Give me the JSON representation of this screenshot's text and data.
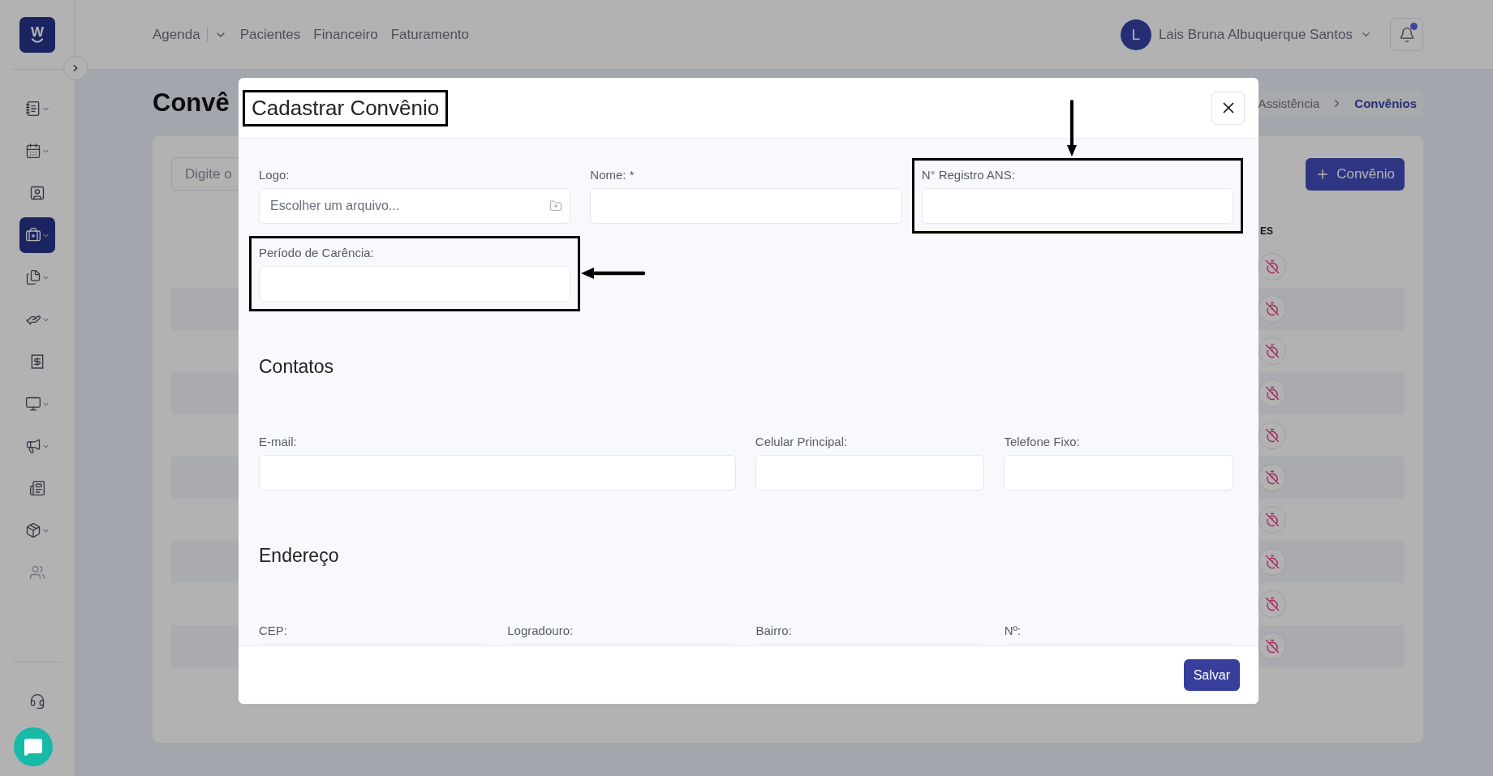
{
  "logo": {
    "letter": "W"
  },
  "sidebar": {
    "items": [
      {
        "kind": "notebook",
        "expandable": true,
        "selected": false,
        "disabled": false
      },
      {
        "kind": "calendar",
        "expandable": true,
        "selected": false,
        "disabled": false
      },
      {
        "kind": "contact",
        "expandable": false,
        "selected": false,
        "disabled": false
      },
      {
        "kind": "medical",
        "expandable": true,
        "selected": true,
        "disabled": false
      },
      {
        "kind": "files",
        "expandable": true,
        "selected": false,
        "disabled": false
      },
      {
        "kind": "care",
        "expandable": true,
        "selected": false,
        "disabled": false
      },
      {
        "kind": "receipt",
        "expandable": false,
        "selected": false,
        "disabled": false
      },
      {
        "kind": "monitor",
        "expandable": true,
        "selected": false,
        "disabled": false
      },
      {
        "kind": "megaphone",
        "expandable": true,
        "selected": false,
        "disabled": false
      },
      {
        "kind": "newspaper",
        "expandable": false,
        "selected": false,
        "disabled": false
      },
      {
        "kind": "package",
        "expandable": true,
        "selected": false,
        "disabled": false
      },
      {
        "kind": "users",
        "expandable": false,
        "selected": false,
        "disabled": true
      }
    ],
    "bottom": [
      {
        "kind": "support"
      }
    ]
  },
  "nav": [
    {
      "label": "Agenda",
      "kind": "dropdown"
    },
    {
      "label": "Pacientes",
      "kind": "link"
    },
    {
      "label": "Financeiro",
      "kind": "link"
    },
    {
      "label": "Faturamento",
      "kind": "link"
    }
  ],
  "user": {
    "initial": "L",
    "name": "Lais Bruna Albuquerque Santos"
  },
  "notifications": {
    "unread": true
  },
  "page": {
    "title": "Convê",
    "breadcrumb": [
      "Assistência",
      "Convênios"
    ],
    "search": {
      "placeholder": "Digite o"
    },
    "add_button": "Convênio",
    "table": {
      "column_label": "ES",
      "rows": [
        {
          "kind": "inactive"
        },
        {
          "kind": "inactive"
        },
        {
          "kind": "inactive"
        },
        {
          "kind": "inactive"
        },
        {
          "kind": "inactive"
        },
        {
          "kind": "inactive"
        },
        {
          "kind": "inactive"
        },
        {
          "kind": "inactive"
        },
        {
          "kind": "inactive"
        },
        {
          "kind": "inactive"
        }
      ]
    }
  },
  "modal": {
    "title": "Cadastrar Convênio",
    "title_highlighted": true,
    "sections": [
      {
        "kind": "three",
        "fields": [
          {
            "label": "Logo:",
            "kind": "file",
            "placeholder": "Escolher um arquivo...",
            "highlighted": false
          },
          {
            "label": "Nome: *",
            "kind": "text",
            "highlighted": false
          },
          {
            "label": "N° Registro ANS:",
            "kind": "text",
            "highlighted": true,
            "arrow": {
              "kind": "down"
            }
          },
          {
            "label": "Período de Carência:",
            "kind": "text",
            "highlighted": true,
            "arrow": {
              "kind": "left"
            }
          }
        ]
      },
      {
        "heading": "Contatos",
        "kind": "contacts",
        "fields": [
          {
            "label": "E-mail:",
            "kind": "text",
            "highlighted": false
          },
          {
            "label": "Celular Principal:",
            "kind": "text",
            "highlighted": false
          },
          {
            "label": "Telefone Fixo:",
            "kind": "text",
            "highlighted": false
          }
        ]
      },
      {
        "heading": "Endereço",
        "kind": "four",
        "fields": [
          {
            "label": "CEP:",
            "kind": "text",
            "highlighted": false
          },
          {
            "label": "Logradouro:",
            "kind": "text",
            "highlighted": false
          },
          {
            "label": "Bairro:",
            "kind": "text",
            "highlighted": false
          },
          {
            "label": "Nº:",
            "kind": "text",
            "highlighted": false
          }
        ]
      }
    ],
    "save_button": "Salvar"
  }
}
